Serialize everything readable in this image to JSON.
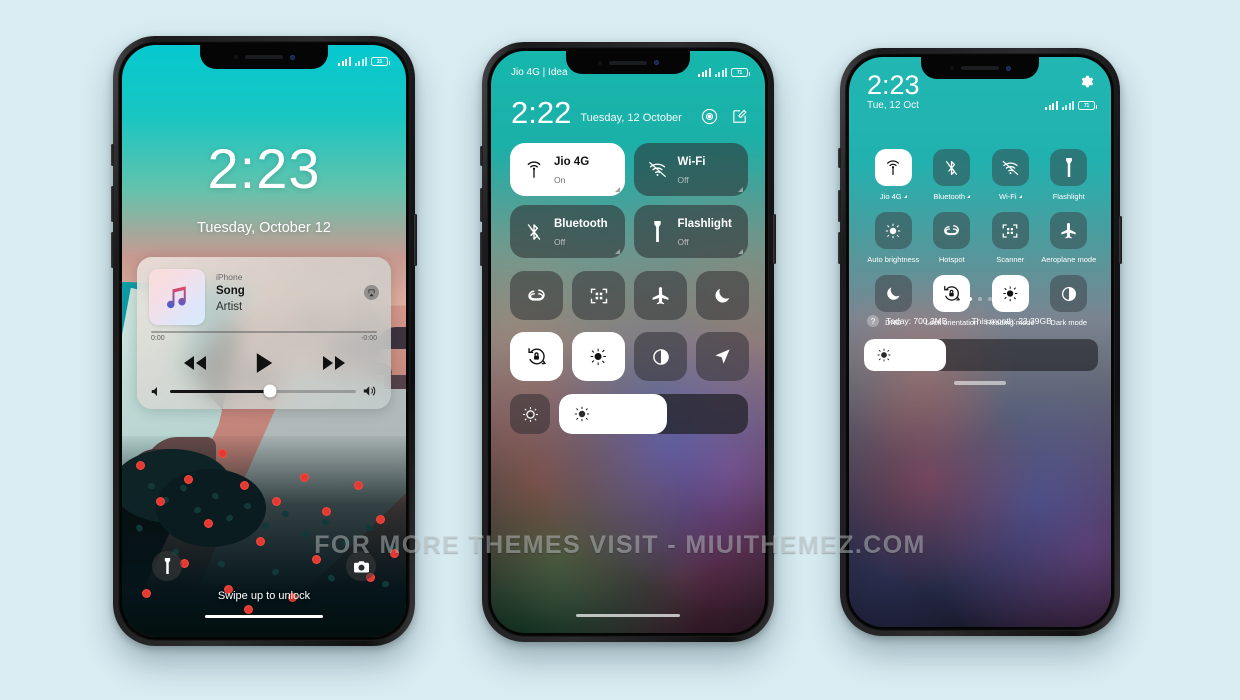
{
  "scene": {
    "background_color": "#d8ecf2",
    "watermark": "FOR MORE THEMES VISIT - MIUITHEMEZ.COM"
  },
  "phone1": {
    "name": "lockscreen",
    "status": {
      "battery": "21"
    },
    "time": "2:23",
    "date": "Tuesday, October 12",
    "music": {
      "device": "iPhone",
      "title": "Song",
      "artist": "Artist",
      "elapsed": "0:00",
      "remaining": "-0:00",
      "album_icon": "music-note-icon",
      "airplay_icon": "airplay-icon",
      "prev_icon": "rewind-icon",
      "play_icon": "play-icon",
      "next_icon": "fast-forward-icon",
      "vol_min_icon": "volume-low-icon",
      "vol_max_icon": "volume-high-icon"
    },
    "bottom": {
      "flashlight_icon": "flashlight-icon",
      "camera_icon": "camera-icon",
      "hint": "Swipe up to unlock"
    }
  },
  "phone2": {
    "name": "ios-control-center",
    "carrier": "Jio 4G | Idea",
    "battery": "71",
    "time": "2:22",
    "date": "Tuesday, 12 October",
    "actions": [
      {
        "icon": "settings-circle-icon",
        "name": "settings-shortcut"
      },
      {
        "icon": "edit-icon",
        "name": "edit-shortcut"
      }
    ],
    "big_tiles": [
      {
        "label": "Jio 4G",
        "state": "On",
        "icon": "cellular-icon",
        "on": true
      },
      {
        "label": "Wi-Fi",
        "state": "Off",
        "icon": "wifi-off-icon",
        "on": false
      },
      {
        "label": "Bluetooth",
        "state": "Off",
        "icon": "bluetooth-off-icon",
        "on": false
      },
      {
        "label": "Flashlight",
        "state": "Off",
        "icon": "flashlight-icon",
        "on": false
      }
    ],
    "sq_row_1": [
      {
        "icon": "hotspot-icon",
        "name": "hotspot-toggle",
        "on": false
      },
      {
        "icon": "scanner-icon",
        "name": "scanner-toggle",
        "on": false
      },
      {
        "icon": "airplane-icon",
        "name": "airplane-toggle",
        "on": false
      },
      {
        "icon": "moon-icon",
        "name": "dnd-toggle",
        "on": false
      }
    ],
    "sq_row_2": [
      {
        "icon": "lock-rotation-icon",
        "name": "lock-orientation-toggle",
        "on": true
      },
      {
        "icon": "reading-mode-icon",
        "name": "reading-mode-toggle",
        "on": true
      },
      {
        "icon": "dark-mode-icon",
        "name": "dark-mode-toggle",
        "on": false
      },
      {
        "icon": "location-icon",
        "name": "location-toggle",
        "on": false
      }
    ],
    "brightness": {
      "auto_icon": "auto-brightness-icon",
      "slider_icon": "brightness-icon",
      "value_percent": 57
    }
  },
  "phone3": {
    "name": "miui-control-center",
    "time": "2:23",
    "date": "Tue, 12 Oct",
    "battery": "71",
    "gear_icon": "gear-icon",
    "tiles": [
      {
        "label": "Jio 4G",
        "icon": "cellular-icon",
        "on": true,
        "arrow": true
      },
      {
        "label": "Bluetooth",
        "icon": "bluetooth-off-icon",
        "on": false,
        "arrow": true
      },
      {
        "label": "Wi-Fi",
        "icon": "wifi-off-icon",
        "on": false,
        "arrow": true
      },
      {
        "label": "Flashlight",
        "icon": "flashlight-icon",
        "on": false,
        "arrow": false
      },
      {
        "label": "Auto brightness",
        "icon": "brightness-icon",
        "on": false,
        "arrow": false
      },
      {
        "label": "Hotspot",
        "icon": "hotspot-icon",
        "on": false,
        "arrow": false
      },
      {
        "label": "Scanner",
        "icon": "scanner-icon",
        "on": false,
        "arrow": false
      },
      {
        "label": "Aeroplane mode",
        "icon": "airplane-icon",
        "on": false,
        "arrow": false
      },
      {
        "label": "DND",
        "icon": "moon-icon",
        "on": false,
        "arrow": false
      },
      {
        "label": "Lock orientation",
        "icon": "lock-rotation-icon",
        "on": true,
        "arrow": false
      },
      {
        "label": "Reading mode",
        "icon": "reading-mode-icon",
        "on": true,
        "arrow": false
      },
      {
        "label": "Dark mode",
        "icon": "dark-mode-icon",
        "on": false,
        "arrow": false
      }
    ],
    "page_dots": {
      "count": 3,
      "active": 0
    },
    "data_usage": {
      "info_icon": "info-icon",
      "today": "Today: 700.3MB",
      "month": "This month: 23.39GB"
    },
    "brightness": {
      "icon": "brightness-icon",
      "value_percent": 35
    }
  }
}
